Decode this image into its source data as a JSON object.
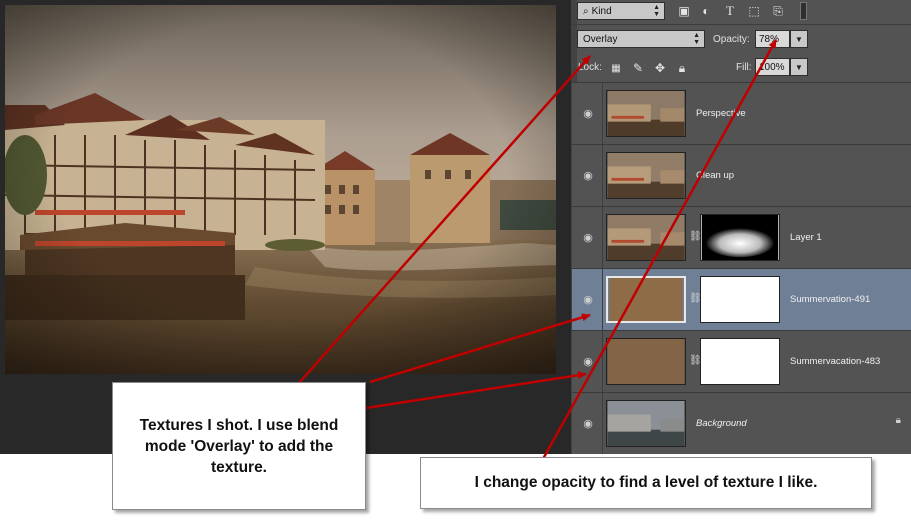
{
  "toolbar": {
    "filter_kind": "Kind",
    "blend_mode": "Overlay",
    "opacity_label": "Opacity:",
    "opacity_value": "78%",
    "lock_label": "Lock:",
    "fill_label": "Fill:",
    "fill_value": "100%"
  },
  "layers": [
    {
      "name": "Perspective",
      "has_mask": false,
      "visible": true,
      "selected": false
    },
    {
      "name": "Clean up",
      "has_mask": false,
      "visible": true,
      "selected": false
    },
    {
      "name": "Layer 1",
      "has_mask": true,
      "visible": true,
      "selected": false
    },
    {
      "name": "Summervation-491",
      "has_mask": true,
      "visible": true,
      "selected": true
    },
    {
      "name": "Summervacation-483",
      "has_mask": true,
      "visible": true,
      "selected": false
    },
    {
      "name": "Background",
      "has_mask": false,
      "visible": true,
      "selected": false,
      "locked": true,
      "italic": true
    }
  ],
  "callouts": {
    "textures": "Textures I shot. I use blend mode 'Overlay' to add the texture.",
    "opacity": "I change opacity to find a level of texture I like."
  },
  "colors": {
    "panel_bg": "#535353",
    "selected_layer": "#6f7f96",
    "arrow": "#c00000"
  },
  "icons": {
    "filter": "search-icon",
    "visibility": "eye-icon",
    "mask_link": "chain-link-icon",
    "background_lock": "lock-icon"
  }
}
